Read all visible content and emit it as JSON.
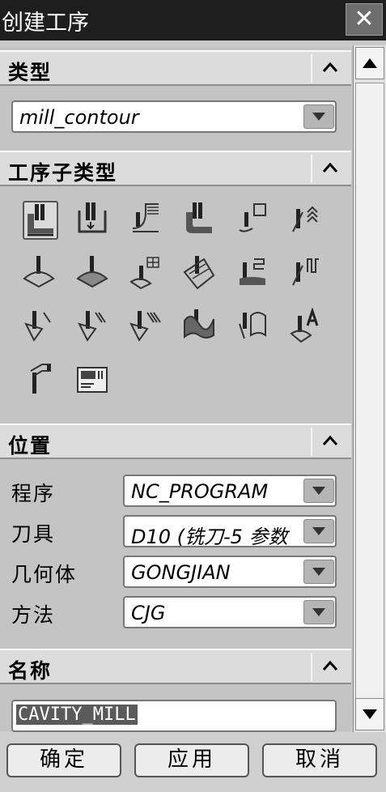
{
  "window": {
    "title": "创建工序",
    "close_glyph": "✕"
  },
  "sections": {
    "type": {
      "label": "类型",
      "value": "mill_contour"
    },
    "subtype": {
      "label": "工序子类型",
      "icons": [
        "cavity-mill-icon",
        "plunge-milling-icon",
        "corner-rough-icon",
        "rest-milling-icon",
        "zlevel-profile-icon",
        "zlevel-corner-icon",
        "fixed-contour-icon",
        "contour-area-icon",
        "contour-surface-area-icon",
        "streamline-icon",
        "contour-area-non-steep-icon",
        "contour-area-dir-steep-icon",
        "flowcut-single-icon",
        "flowcut-multiple-icon",
        "flowcut-ref-tool-icon",
        "solid-profile-3d-icon",
        "profile-3d-icon",
        "contour-text-icon",
        "mill-user-icon",
        "mill-control-icon"
      ]
    },
    "position": {
      "label": "位置",
      "fields": [
        {
          "label": "程序",
          "value": "NC_PROGRAM"
        },
        {
          "label": "刀具",
          "value": "D10 (铣刀-5 参数"
        },
        {
          "label": "几何体",
          "value": "GONGJIAN"
        },
        {
          "label": "方法",
          "value": "CJG"
        }
      ]
    },
    "name": {
      "label": "名称",
      "value": "CAVITY_MILL"
    }
  },
  "buttons": {
    "ok": "确定",
    "apply": "应用",
    "cancel": "取消"
  }
}
